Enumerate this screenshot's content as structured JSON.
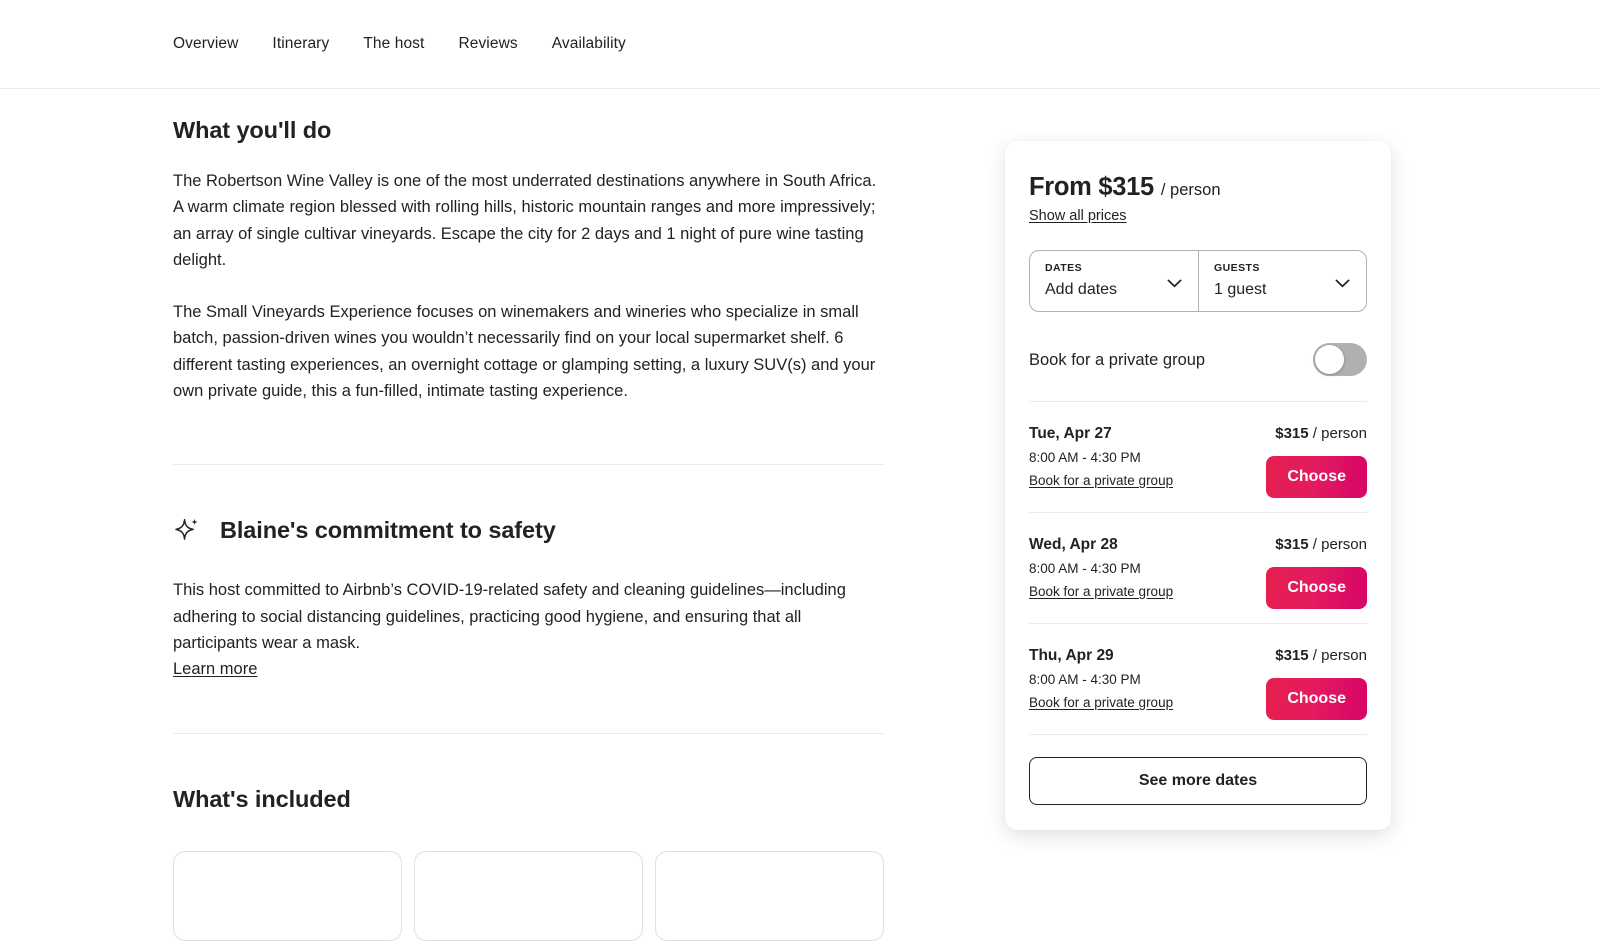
{
  "nav": {
    "items": [
      {
        "label": "Overview"
      },
      {
        "label": "Itinerary"
      },
      {
        "label": "The host"
      },
      {
        "label": "Reviews"
      },
      {
        "label": "Availability"
      }
    ]
  },
  "main": {
    "what_youll_do": {
      "title": "What you'll do",
      "paragraph_1": "The Robertson Wine Valley is one of the most underrated destinations anywhere in South Africa. A warm climate region blessed with rolling hills, historic mountain ranges and more impressively; an array of single cultivar vineyards. Escape the city for 2 days and 1 night of pure wine tasting delight.",
      "paragraph_2": "The Small Vineyards Experience focuses on winemakers and wineries who specialize in small batch, passion-driven wines you wouldn’t necessarily find on your local supermarket shelf. 6 different tasting experiences, an overnight cottage or glamping setting, a luxury SUV(s) and your own private guide, this a fun-filled, intimate tasting experience."
    },
    "safety": {
      "icon": "sparkle-icon",
      "title": "Blaine's commitment to safety",
      "body": "This host committed to Airbnb’s COVID-19-related safety and cleaning guidelines—including adhering to social distancing guidelines, practicing good hygiene, and ensuring that all participants wear a mask.",
      "learn_more_label": "Learn more"
    },
    "whats_included": {
      "title": "What's included",
      "cards": [
        {},
        {},
        {}
      ]
    }
  },
  "booking": {
    "price_from": "From $315",
    "price_unit": "/ person",
    "show_all_prices_label": "Show all prices",
    "selectors": [
      {
        "label": "DATES",
        "value": "Add dates",
        "icon": "chevron-down-icon"
      },
      {
        "label": "GUESTS",
        "value": "1 guest",
        "icon": "chevron-down-icon"
      }
    ],
    "private_group_toggle": {
      "label": "Book for a private group",
      "state": "off"
    },
    "dates": [
      {
        "day": "Tue, Apr 27",
        "time": "8:00 AM - 4:30 PM",
        "private_link": "Book for a private group",
        "price": "$315",
        "price_unit": "/ person",
        "choose_label": "Choose"
      },
      {
        "day": "Wed, Apr 28",
        "time": "8:00 AM - 4:30 PM",
        "private_link": "Book for a private group",
        "price": "$315",
        "price_unit": "/ person",
        "choose_label": "Choose"
      },
      {
        "day": "Thu, Apr 29",
        "time": "8:00 AM - 4:30 PM",
        "private_link": "Book for a private group",
        "price": "$315",
        "price_unit": "/ person",
        "choose_label": "Choose"
      }
    ],
    "see_more_dates_label": "See more dates"
  },
  "colors": {
    "accent_gradient_start": "#E61E4D",
    "accent_gradient_end": "#D70466",
    "text": "#222222",
    "divider": "#ebebeb",
    "toggle_off": "#b0b0b0"
  }
}
